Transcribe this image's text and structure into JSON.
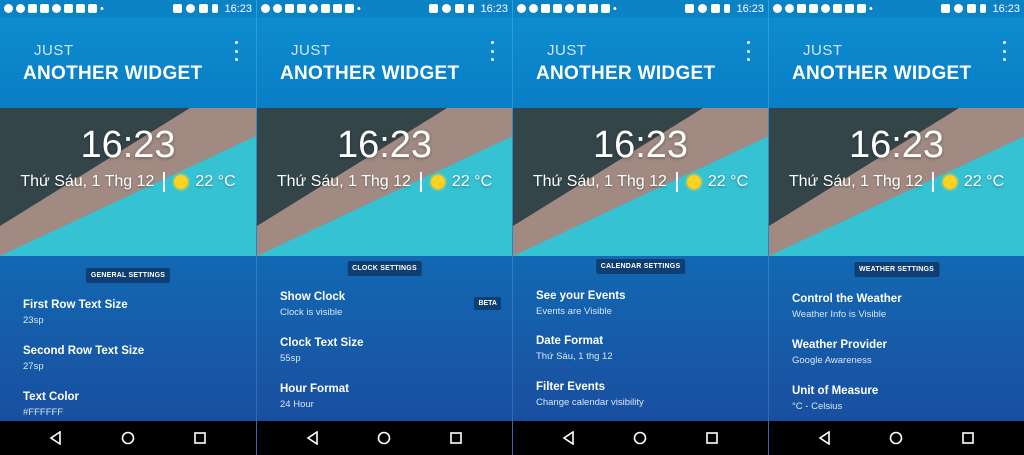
{
  "status": {
    "time": "16:23"
  },
  "screens": [
    {
      "brand_top": "JUST",
      "brand_bottom": "ANOTHER WIDGET",
      "clock": "16:23",
      "date": "Thứ Sáu, 1 Thg 12",
      "temperature": "22 °C",
      "section": "GENERAL SETTINGS",
      "settings": [
        {
          "title": "First Row Text Size",
          "subtitle": "23sp"
        },
        {
          "title": "Second Row Text Size",
          "subtitle": "27sp"
        },
        {
          "title": "Text Color",
          "subtitle": "#FFFFFF"
        }
      ]
    },
    {
      "brand_top": "JUST",
      "brand_bottom": "ANOTHER WIDGET",
      "clock": "16:23",
      "date": "Thứ Sáu, 1 Thg 12",
      "temperature": "22 °C",
      "section": "CLOCK SETTINGS",
      "badge": "BETA",
      "settings": [
        {
          "title": "Show Clock",
          "subtitle": "Clock is visible"
        },
        {
          "title": "Clock Text Size",
          "subtitle": "55sp"
        },
        {
          "title": "Hour Format",
          "subtitle": "24 Hour"
        }
      ]
    },
    {
      "brand_top": "JUST",
      "brand_bottom": "ANOTHER WIDGET",
      "clock": "16:23",
      "date": "Thứ Sáu, 1 Thg 12",
      "temperature": "22 °C",
      "section": "CALENDAR SETTINGS",
      "settings": [
        {
          "title": "See your Events",
          "subtitle": "Events are Visible"
        },
        {
          "title": "Date Format",
          "subtitle": "Thứ Sáu, 1 thg 12"
        },
        {
          "title": "Filter Events",
          "subtitle": "Change calendar visibility"
        }
      ]
    },
    {
      "brand_top": "JUST",
      "brand_bottom": "ANOTHER WIDGET",
      "clock": "16:23",
      "date": "Thứ Sáu, 1 Thg 12",
      "temperature": "22 °C",
      "section": "WEATHER SETTINGS",
      "settings": [
        {
          "title": "Control the Weather",
          "subtitle": "Weather Info is Visible"
        },
        {
          "title": "Weather Provider",
          "subtitle": "Google Awareness"
        },
        {
          "title": "Unit of Measure",
          "subtitle": "°C - Celsius"
        }
      ]
    }
  ],
  "icons": {
    "status_left": [
      "messenger-icon",
      "messenger-icon",
      "youtube-icon",
      "gallery-icon",
      "messenger-icon",
      "play-store-icon",
      "play-store-icon",
      "play-store-icon",
      "more-dots-icon"
    ],
    "status_right": [
      "vibrate-icon",
      "wifi-icon",
      "signal-icon",
      "battery-icon"
    ],
    "weather": "sun-icon",
    "nav": [
      "back-icon",
      "home-icon",
      "recents-icon"
    ]
  },
  "colors": {
    "header_blue": "#0d8fd0",
    "chip_bg": "#0f3f72",
    "banner_dark": "#344549",
    "banner_taupe": "#a08a82",
    "banner_cyan": "#35c2d3",
    "sun": "#ffd21f"
  }
}
